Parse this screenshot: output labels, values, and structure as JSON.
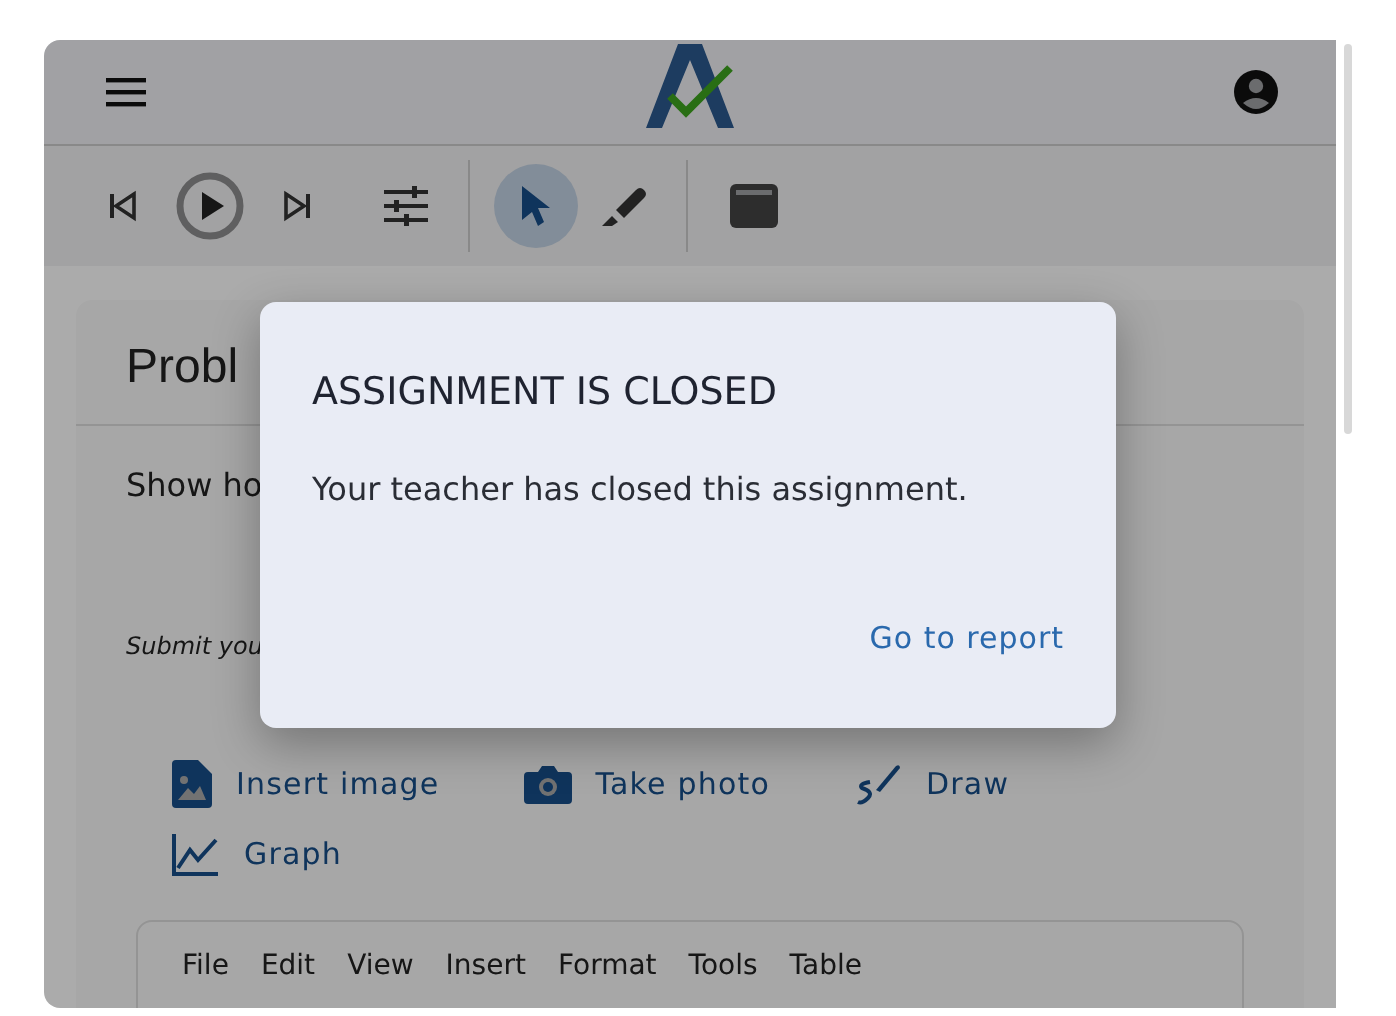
{
  "toolbar": {
    "tools": [
      {
        "kind": "prev",
        "selected": false
      },
      {
        "kind": "play",
        "selected": false
      },
      {
        "kind": "next",
        "selected": false
      },
      {
        "kind": "sliders",
        "selected": false
      },
      {
        "kind": "pointer",
        "selected": true
      },
      {
        "kind": "marker",
        "selected": false
      },
      {
        "kind": "window",
        "selected": false
      }
    ]
  },
  "problem": {
    "title": "Probl",
    "prompt": "Show ho",
    "instruction": "Submit you"
  },
  "attachments": [
    {
      "kind": "image",
      "label": "Insert image"
    },
    {
      "kind": "camera",
      "label": "Take photo"
    },
    {
      "kind": "draw",
      "label": "Draw"
    },
    {
      "kind": "graph",
      "label": "Graph"
    }
  ],
  "editor": {
    "menu": [
      "File",
      "Edit",
      "View",
      "Insert",
      "Format",
      "Tools",
      "Table"
    ]
  },
  "dialog": {
    "title": "ASSIGNMENT IS CLOSED",
    "message": "Your teacher has closed this assignment.",
    "action": "Go to report"
  }
}
